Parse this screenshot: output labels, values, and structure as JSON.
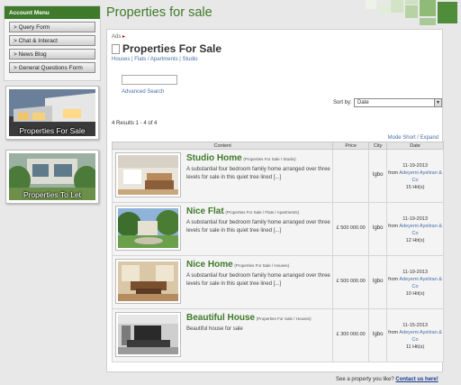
{
  "sidebar": {
    "title": "Account Menu",
    "items": [
      {
        "label": "> Query Form"
      },
      {
        "label": "> Chat & Interact"
      },
      {
        "label": "> News Blog"
      },
      {
        "label": "> General Questions Form"
      }
    ],
    "banners": [
      {
        "label": "Properties For Sale"
      },
      {
        "label": "Properties To Let"
      }
    ]
  },
  "header": {
    "title": "Properties for sale"
  },
  "content": {
    "breadcrumb": "Ads",
    "list_title": "Properties For Sale",
    "categories": "Houses | Flats / Apartments | Studio",
    "search_placeholder": "",
    "advanced_search": "Advanced Search",
    "sort_label": "Sort by:",
    "sort_value": "Date",
    "results": "4 Results 1 - 4 of 4",
    "mode": "Mode Short / Expand",
    "columns": {
      "content": "Content",
      "price": "Price",
      "city": "City",
      "date": "Date"
    },
    "rows": [
      {
        "title": "Studio Home",
        "category": "(Properties For Sale / Studio)",
        "description": "A substantial four bedroom family home arranged over three levels for sale in this quiet tree lined [...]",
        "price": "",
        "city": "Igbo",
        "date": "11-19-2013",
        "from": "from",
        "agent": "Adeyemi Ayeliran & Co",
        "hits": "15 Hit(s)"
      },
      {
        "title": "Nice Flat",
        "category": "(Properties For Sale / Flats / Apartments)",
        "description": "A substantial four bedroom family home arranged over three levels for sale in this quiet tree lined [...]",
        "price": "£ 500 000.00",
        "city": "Igbo",
        "date": "11-19-2013",
        "from": "from",
        "agent": "Adeyemi Ayeliran & Co",
        "hits": "12 Hit(s)"
      },
      {
        "title": "Nice Home",
        "category": "(Properties For Sale / Houses)",
        "description": "A substantial four bedroom family home arranged over three levels for sale in this quiet tree lined [...]",
        "price": "£ 500 000.00",
        "city": "Igbo",
        "date": "11-19-2013",
        "from": "from",
        "agent": "Adeyemi Ayeliran & Co",
        "hits": "10 Hit(s)"
      },
      {
        "title": "Beautiful House",
        "category": "(Properties For Sale / Houses)",
        "description": "Beautiful house for sale",
        "price": "£ 300 000.00",
        "city": "Igbo",
        "date": "11-15-2013",
        "from": "from",
        "agent": "Adeyemi Ayeliran & Co",
        "hits": "11 Hit(s)"
      }
    ]
  },
  "footer": {
    "question": "See a property you like?",
    "contact": "Contact us here!"
  },
  "colors": {
    "brand_green": "#3f7a2a",
    "link_blue": "#4a6ea8"
  }
}
